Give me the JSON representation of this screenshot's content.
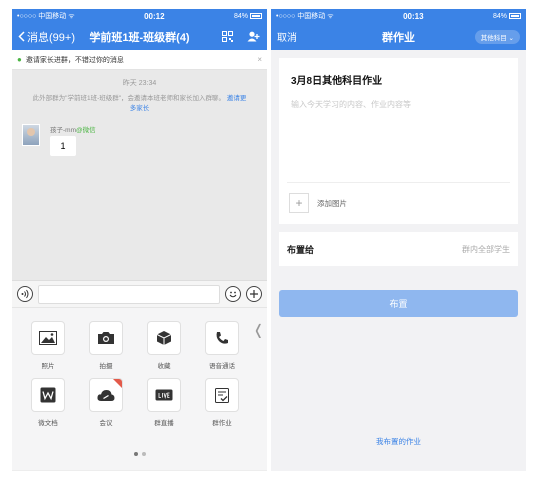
{
  "left_screen": {
    "status": {
      "carrier": "•○○○○ 中国移动 ᯤ",
      "time": "00:12",
      "battery": "84%"
    },
    "nav": {
      "back_label": "消息(99+)",
      "title": "学前班1班-班级群(4)",
      "qr_icon": "qr-code-icon",
      "members_icon": "group-members-icon"
    },
    "notice": {
      "text": "邀请家长进群，不错过你的消息",
      "close": "×"
    },
    "chat": {
      "timestamp": "昨天 23:34",
      "system_message": "此外部群为\"学前班1班-班级群\"，会邀请本班老师和家长加入群聊。",
      "invite_link": "邀请更多家长",
      "message": {
        "sender": "孩子-mm",
        "sender_tag": "@微信",
        "text": "1"
      }
    },
    "input": {
      "voice_icon": "voice-icon",
      "emoji_icon": "emoji-icon",
      "plus_icon": "plus-icon"
    },
    "panel": {
      "items": [
        {
          "label": "照片",
          "icon": "photo-icon"
        },
        {
          "label": "拍摄",
          "icon": "camera-icon"
        },
        {
          "label": "收藏",
          "icon": "favorites-icon"
        },
        {
          "label": "语音通话",
          "icon": "phone-icon"
        },
        {
          "label": "微文档",
          "icon": "document-icon"
        },
        {
          "label": "会议",
          "icon": "meeting-cloud-icon"
        },
        {
          "label": "群直播",
          "icon": "live-icon"
        },
        {
          "label": "群作业",
          "icon": "homework-icon"
        }
      ],
      "page_indicator": {
        "pages": 2,
        "current": 1
      }
    }
  },
  "right_screen": {
    "status": {
      "carrier": "•○○○○ 中国移动 ᯤ",
      "time": "00:13",
      "battery": "84%"
    },
    "nav": {
      "cancel_label": "取消",
      "title": "群作业",
      "subject_pill": "其他科目 ⌄"
    },
    "form": {
      "title": "3月8日其他科目作业",
      "placeholder": "输入今天学习的内容、作业内容等",
      "add_image_label": "添加图片",
      "assign_label": "布置给",
      "assign_value": "群内全部学生",
      "publish_button": "布置",
      "my_homework_link": "我布置的作业"
    }
  },
  "colors": {
    "brand_blue": "#3b83e6",
    "button_disabled": "#8fb7ef",
    "wechat_green": "#4bb543",
    "badge_red": "#e35a4a"
  }
}
